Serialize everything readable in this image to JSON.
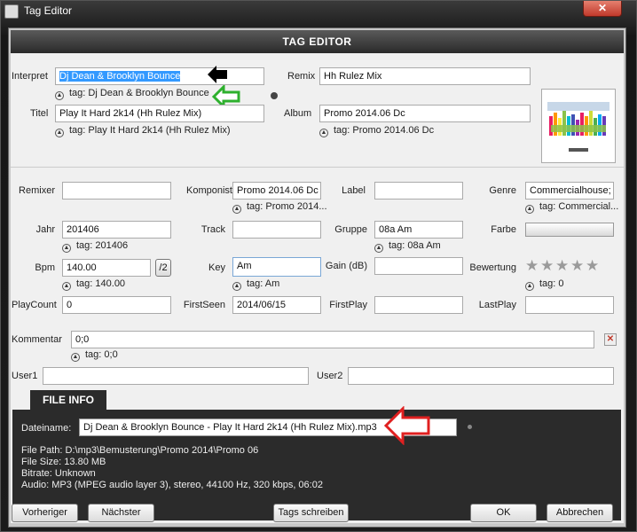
{
  "window": {
    "title": "Tag Editor",
    "close": "✕"
  },
  "header": {
    "title": "TAG EDITOR"
  },
  "top": {
    "interpret_label": "Interpret",
    "interpret_value": "Dj Dean & Brooklyn Bounce",
    "interpret_tag": "tag: Dj Dean & Brooklyn Bounce",
    "remix_label": "Remix",
    "remix_value": "Hh Rulez Mix",
    "titel_label": "Titel",
    "titel_value": "Play It Hard 2k14 (Hh Rulez Mix)",
    "titel_tag": "tag: Play It Hard 2k14 (Hh Rulez Mix)",
    "album_label": "Album",
    "album_value": "Promo 2014.06 Dc",
    "album_tag": "tag: Promo 2014.06 Dc"
  },
  "fields": {
    "remixer_label": "Remixer",
    "remixer_value": "",
    "komponist_label": "Komponist",
    "komponist_value": "Promo 2014.06 Dc",
    "komponist_tag": "tag: Promo 2014....",
    "label_label": "Label",
    "label_value": "",
    "genre_label": "Genre",
    "genre_value": "Commercialhouse; C",
    "genre_tag": "tag: Commercial...",
    "jahr_label": "Jahr",
    "jahr_value": "201406",
    "jahr_tag": "tag: 201406",
    "track_label": "Track",
    "track_value": "",
    "gruppe_label": "Gruppe",
    "gruppe_value": "08a Am",
    "gruppe_tag": "tag: 08a Am",
    "farbe_label": "Farbe",
    "bpm_label": "Bpm",
    "bpm_value": "140.00",
    "bpm_tag": "tag: 140.00",
    "bpm_div": "/2",
    "key_label": "Key",
    "key_value": "Am",
    "key_tag": "tag: Am",
    "gain_label": "Gain (dB)",
    "gain_value": "",
    "bewertung_label": "Bewertung",
    "bewertung_tag": "tag: 0",
    "rating": 0,
    "rating_max": 5,
    "playcount_label": "PlayCount",
    "playcount_value": "0",
    "firstseen_label": "FirstSeen",
    "firstseen_value": "2014/06/15",
    "firstplay_label": "FirstPlay",
    "firstplay_value": "",
    "lastplay_label": "LastPlay",
    "lastplay_value": "",
    "kommentar_label": "Kommentar",
    "kommentar_value": "0;0",
    "kommentar_tag": "tag: 0;0",
    "user1_label": "User1",
    "user1_value": "",
    "user2_label": "User2",
    "user2_value": ""
  },
  "fileinfo": {
    "tab": "FILE INFO",
    "dateiname_label": "Dateiname:",
    "dateiname_value": "Dj Dean & Brooklyn Bounce - Play It Hard 2k14 (Hh Rulez Mix).mp3",
    "path": "File Path: D:\\mp3\\Bemusterung\\Promo 2014\\Promo 06",
    "size": "File Size: 13.80 MB",
    "bitrate": "Bitrate: Unknown",
    "audio": "Audio: MP3 (MPEG audio layer 3), stereo, 44100 Hz, 320 kbps, 06:02"
  },
  "buttons": {
    "prev": "Vorheriger",
    "next": "Nächster",
    "write": "Tags schreiben",
    "ok": "OK",
    "cancel": "Abbrechen"
  },
  "colors": {
    "selection": "#3399ff",
    "arrow_black": "#000000",
    "arrow_green": "#2db02d",
    "arrow_red": "#e02020"
  }
}
